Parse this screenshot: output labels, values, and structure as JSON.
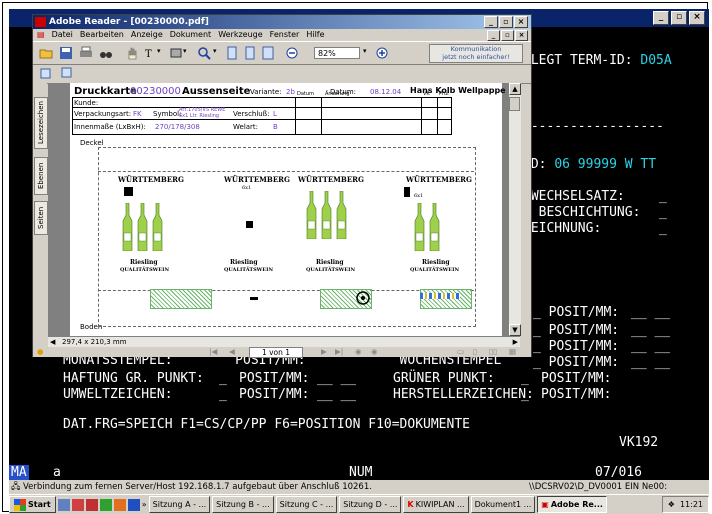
{
  "terminal": {
    "header_line": "ELEGT TERM-ID: D05A",
    "header_prefix": "ELEGT TERM-ID: ",
    "term_id": "D05A",
    "dashes": "------------------",
    "nd_label": "ND: ",
    "nd_value": "06 99999 W TT",
    "lines_right": [
      "SWECHSELSATZ:",
      "R BESCHICHTUNG:",
      "ZEICHNUNG:"
    ],
    "posit_right": [
      "_ POSIT/MM:",
      "_ POSIT/MM:",
      "_ POSIT/MM:",
      "_ POSIT/MM:"
    ],
    "partial_row": "MONATSSTEMPEL:        POSIT/MM:            WOCHENSTEMPEL",
    "row1": {
      "a": "HAFTUNG GR. PUNKT:",
      "b": "POSIT/MM:",
      "c": "GRÜNER PUNKT:",
      "d": "POSIT/MM:"
    },
    "row2": {
      "a": "UMWELTZEICHEN:",
      "b": "POSIT/MM:",
      "c": "HERSTELLERZEICHEN:",
      "d": "POSIT/MM:"
    },
    "fkeys": "DAT.FRG=SPEICH F1=CS/CP/PP F6=POSITION F10=DOKUMENTE",
    "code": "VK192",
    "status": {
      "left": "MA",
      "a": "a",
      "mode": "NUM",
      "pos": "07/016"
    }
  },
  "connection": {
    "text": "Verbindung zum fernen Server/Host 192.168.1.7 aufgebaut über Anschluß 10261.",
    "session": "\\\\DCSRV02\\D_DV0001 EIN Ne00:"
  },
  "taskbar": {
    "start": "Start",
    "tasks": [
      "Sitzung A - ...",
      "Sitzung B - ...",
      "Sitzung C - ...",
      "Sitzung D - ...",
      "KIWIPLAN ...",
      "Dokument1 ...",
      "Adobe Re..."
    ],
    "clock": "11:21"
  },
  "reader": {
    "title": "Adobe Reader - [00230000.pdf]",
    "menu": [
      "Datei",
      "Bearbeiten",
      "Anzeige",
      "Dokument",
      "Werkzeuge",
      "Fenster",
      "Hilfe"
    ],
    "zoom": "82%",
    "kommunikation": [
      "Kommunikation",
      "jetzt noch einfacher!"
    ],
    "side_tabs": [
      "Lesezeichen",
      "Ebenen",
      "Seiten"
    ],
    "page_size": "297,4 x 210,3 mm",
    "page_indicator": "1 von 1"
  },
  "document": {
    "title_label": "Druckkarte",
    "title_number": "00230000",
    "title_side": "Aussenseite",
    "variante_label": "Variante:",
    "variante_value": "2b",
    "datum_label": "Datum:",
    "datum_value": "08.12.04",
    "company": "Hans Kolb Wellpappe",
    "kunde_label": "Kunde:",
    "col_datum": "Datum",
    "col_aenderung": "Änderung",
    "col_vk": "VK",
    "col_pruf": "Prüf",
    "verpackungsart_label": "Verpackungsart:",
    "verpackungsart_value": "FK",
    "symbol_label": "Symbol:",
    "symbol_value": [
      "Art.1705/VS REWE",
      "6x1 Ltr. Riesling"
    ],
    "verschluss_label": "Verschluß:",
    "verschluss_value": "L",
    "innenmasse_label": "Innenmaße (LxBxH):",
    "innenmasse_value": "270/178/308",
    "welart_label": "Welart:",
    "welart_value": "B",
    "deckel": "Deckel",
    "boden": "Boden",
    "brand": "WÜRTTEMBERG",
    "brand_sub": "6x1",
    "sort": "Riesling",
    "quality": "QUALITÄTSWEIN"
  }
}
